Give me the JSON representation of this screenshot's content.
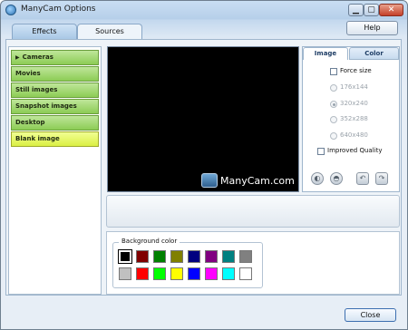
{
  "window": {
    "title": "ManyCam Options",
    "close_glyph": "✕"
  },
  "tabs": [
    {
      "label": "Effects"
    },
    {
      "label": "Sources"
    }
  ],
  "help_label": "Help",
  "sources": [
    {
      "label": "Cameras",
      "expander": "▶"
    },
    {
      "label": "Movies"
    },
    {
      "label": "Still images"
    },
    {
      "label": "Snapshot images"
    },
    {
      "label": "Desktop"
    },
    {
      "label": "Blank image"
    }
  ],
  "preview": {
    "logo_text": "ManyCam.com"
  },
  "image_panel": {
    "tabs": [
      {
        "label": "Image"
      },
      {
        "label": "Color"
      }
    ],
    "force_size_label": "Force size",
    "sizes": [
      "176x144",
      "320x240",
      "352x288",
      "640x480"
    ],
    "selected_size": "320x240",
    "improved_quality_label": "Improved Quality"
  },
  "background": {
    "label": "Background color",
    "selected_color": "#000000",
    "colors": [
      "#000000",
      "#800000",
      "#008000",
      "#808000",
      "#000080",
      "#800080",
      "#008080",
      "#808080",
      "#c0c0c0",
      "#ff0000",
      "#00ff00",
      "#ffff00",
      "#0000ff",
      "#ff00ff",
      "#00ffff",
      "#ffffff"
    ]
  },
  "close_label": "Close"
}
